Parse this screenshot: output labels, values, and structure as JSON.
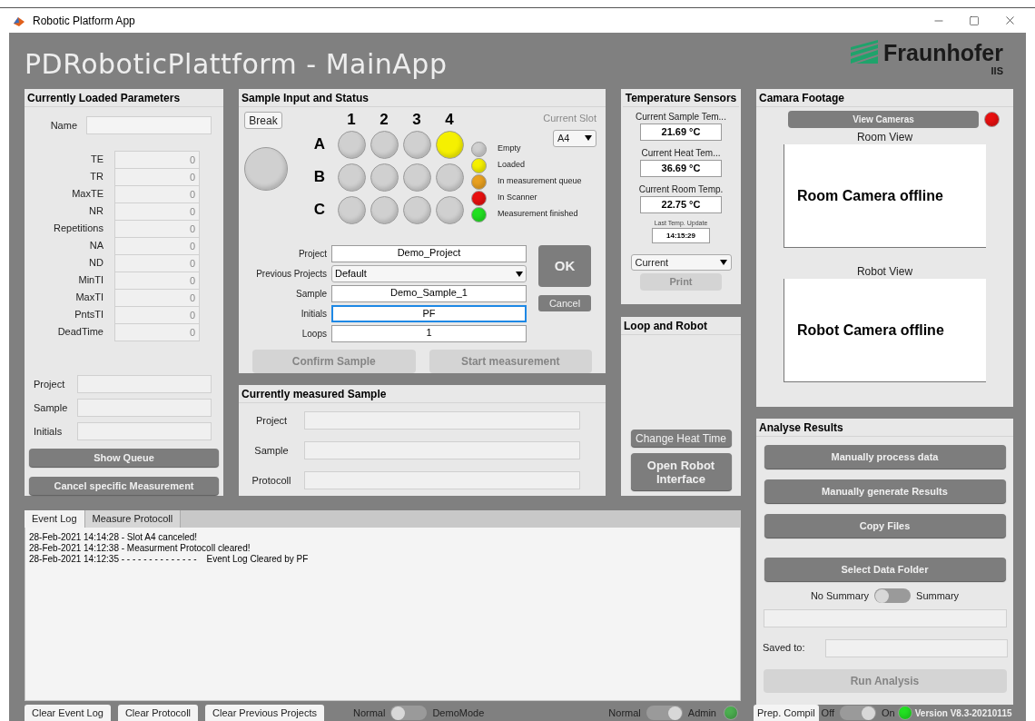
{
  "window": {
    "title": "Robotic Platform App"
  },
  "header": {
    "title": "PDRoboticPlattform - MainApp",
    "logo_name": "Fraunhofer",
    "logo_sub": "IIS"
  },
  "parameters": {
    "title": "Currently Loaded Parameters",
    "name_label": "Name",
    "fields": [
      {
        "label": "TE",
        "value": "0"
      },
      {
        "label": "TR",
        "value": "0"
      },
      {
        "label": "MaxTE",
        "value": "0"
      },
      {
        "label": "NR",
        "value": "0"
      },
      {
        "label": "Repetitions",
        "value": "0"
      },
      {
        "label": "NA",
        "value": "0"
      },
      {
        "label": "ND",
        "value": "0"
      },
      {
        "label": "MinTI",
        "value": "0"
      },
      {
        "label": "MaxTI",
        "value": "0"
      },
      {
        "label": "PntsTI",
        "value": "0"
      },
      {
        "label": "DeadTime",
        "value": "0"
      }
    ],
    "info": [
      {
        "label": "Project"
      },
      {
        "label": "Sample"
      },
      {
        "label": "Initials"
      }
    ],
    "buttons": [
      {
        "label": "Show Queue",
        "disabled": false
      },
      {
        "label": "Cancel  specific Measurement",
        "disabled": false
      }
    ]
  },
  "sample_input": {
    "title": "Sample Input and Status",
    "break_button": "Break",
    "main_lamp": {
      "color": "#d0d0d0"
    },
    "columns": [
      "1",
      "2",
      "3",
      "4"
    ],
    "rows": [
      {
        "label": "A",
        "slots": [
          {
            "color": "#d0d0d0"
          },
          {
            "color": "#d0d0d0"
          },
          {
            "color": "#d0d0d0"
          },
          {
            "color": "#f5f000"
          }
        ]
      },
      {
        "label": "B",
        "slots": [
          {
            "color": "#d0d0d0"
          },
          {
            "color": "#d0d0d0"
          },
          {
            "color": "#d0d0d0"
          },
          {
            "color": "#d0d0d0"
          }
        ]
      },
      {
        "label": "C",
        "slots": [
          {
            "color": "#d0d0d0"
          },
          {
            "color": "#d0d0d0"
          },
          {
            "color": "#d0d0d0"
          },
          {
            "color": "#d0d0d0"
          }
        ]
      }
    ],
    "legend": [
      {
        "label": "Empty",
        "color": "#d0d0d0"
      },
      {
        "label": "Loaded",
        "color": "#f5f000"
      },
      {
        "label": "In measurement queue",
        "color": "#e8a020"
      },
      {
        "label": "In Scanner",
        "color": "#e81010"
      },
      {
        "label": "Measurement finished",
        "color": "#22e022"
      }
    ],
    "current_slot": {
      "label": "Current Slot",
      "value": "A4"
    },
    "form": [
      {
        "kind": "text",
        "label": "Project",
        "value": "Demo_Project",
        "focused": false
      },
      {
        "kind": "dropdown",
        "label": "Previous Projects",
        "value": "Default",
        "focused": false
      },
      {
        "kind": "text",
        "label": "Sample",
        "value": "Demo_Sample_1",
        "focused": false
      },
      {
        "kind": "text",
        "label": "Initials",
        "value": "PF",
        "focused": true
      },
      {
        "kind": "text",
        "label": "Loops",
        "value": "1",
        "focused": false
      }
    ],
    "ok_button": "OK",
    "cancel_button": "Cancel",
    "buttons": [
      {
        "label": "Confirm Sample",
        "disabled": true
      },
      {
        "label": "Start measurement",
        "disabled": true
      }
    ]
  },
  "measured": {
    "title": "Currently measured Sample",
    "fields": [
      {
        "label": "Project"
      },
      {
        "label": "Sample"
      },
      {
        "label": "Protocoll"
      }
    ]
  },
  "temperature": {
    "title": "Temperature Sensors",
    "readings": [
      {
        "label": "Current Sample Tem...",
        "value": "21.69 °C"
      },
      {
        "label": "Current Heat Tem...",
        "value": "36.69 °C"
      },
      {
        "label": "Current Room Temp.",
        "value": "22.75 °C"
      }
    ],
    "update_label": "Last Temp. Update",
    "update_value": "14:15:29",
    "mode": "Current",
    "print_button": {
      "label": "Print",
      "disabled": true
    }
  },
  "loop_robot": {
    "title": "Loop and Robot",
    "buttons": [
      {
        "label": "Change Heat Time",
        "disabled": false
      },
      {
        "label": "Open Robot Interface",
        "disabled": false
      }
    ]
  },
  "camera": {
    "title": "Camara Footage",
    "view_button": "View Cameras",
    "status_lamp": {
      "color": "#e81010"
    },
    "views": [
      {
        "label": "Room View",
        "message": "Room Camera offline"
      },
      {
        "label": "Robot View",
        "message": "Robot Camera offline"
      }
    ]
  },
  "analyse": {
    "title": "Analyse Results",
    "buttons": [
      {
        "label": "Manually process data",
        "disabled": false
      },
      {
        "label": "Manually generate Results",
        "disabled": false
      },
      {
        "label": "Copy Files",
        "disabled": false
      }
    ],
    "folder_button": "Select Data Folder",
    "summary_toggle": {
      "off_label": "No Summary",
      "on_label": "Summary",
      "on": false
    },
    "saved_label": "Saved to:",
    "run_button": {
      "label": "Run Analysis",
      "disabled": true
    }
  },
  "log": {
    "tabs": [
      {
        "label": "Event Log",
        "selected": true
      },
      {
        "label": "Measure Protocoll",
        "selected": false
      }
    ],
    "lines": [
      "28-Feb-2021 14:14:28 - Slot A4 canceled!",
      "28-Feb-2021 14:12:38 - Measurment Protocoll cleared!",
      "28-Feb-2021 14:12:35 - - - - - - - - - - - - - -    Event Log Cleared by PF"
    ]
  },
  "bottom": {
    "buttons": [
      "Clear Event Log",
      "Clear Protocoll",
      "Clear Previous Projects"
    ],
    "toggles": [
      {
        "off_label": "Normal",
        "on_label": "DemoMode",
        "on": false
      },
      {
        "off_label": "Normal",
        "on_label": "Admin",
        "on": true
      }
    ],
    "admin_lamp": {
      "color": "#4caf50"
    },
    "compiler": {
      "button": "Prep. Compil",
      "off_label": "Off",
      "on_label": "On",
      "on": true
    },
    "compiler_lamp": {
      "color": "#22e022"
    },
    "version": "Version V8.3-20210115"
  }
}
